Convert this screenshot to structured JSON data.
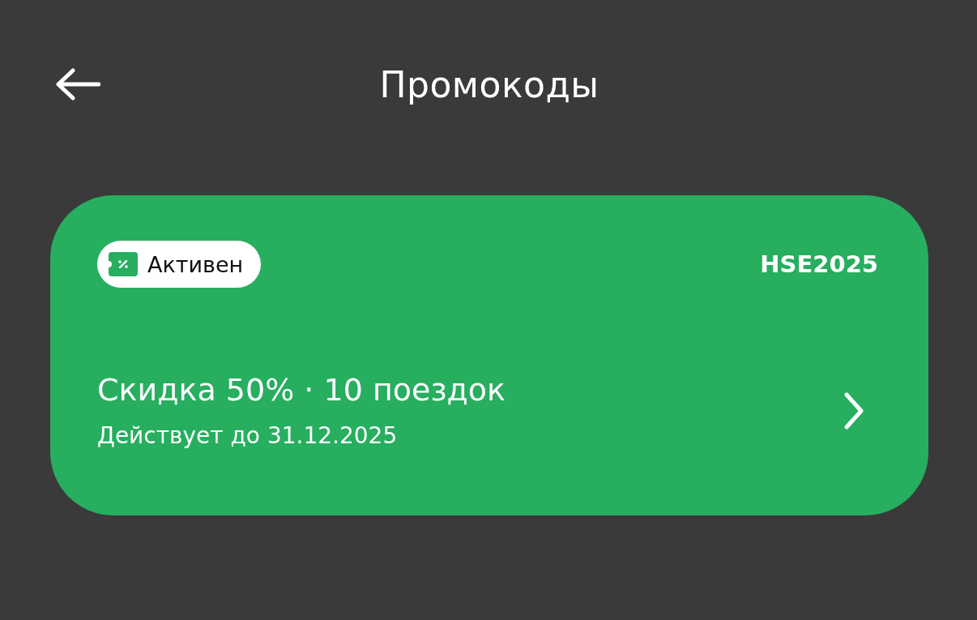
{
  "header": {
    "title": "Промокоды"
  },
  "promos": [
    {
      "status": {
        "label": "Активен",
        "active": true
      },
      "code": "HSE2025",
      "title": "Скидка 50% · 10 поездок",
      "validity": "Действует до 31.12.2025"
    }
  ]
}
